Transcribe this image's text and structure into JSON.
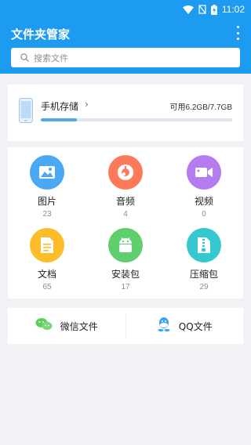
{
  "status_bar": {
    "time": "11:02",
    "icons": [
      "wifi-icon",
      "signal-off-icon",
      "battery-charging-icon"
    ]
  },
  "app_bar": {
    "title": "文件夹管家",
    "menu_icon": "more-vert-icon"
  },
  "search": {
    "placeholder": "搜索文件",
    "icon": "search-icon"
  },
  "storage": {
    "title": "手机存储",
    "chevron": "›",
    "summary": "可用6.2GB/7.7GB",
    "used_fraction": 0.19,
    "icon": "phone-icon"
  },
  "categories": [
    {
      "label": "图片",
      "count": "23",
      "icon": "image-icon",
      "color": "#4aa8f4"
    },
    {
      "label": "音频",
      "count": "4",
      "icon": "music-icon",
      "color": "#ff7a5a"
    },
    {
      "label": "视频",
      "count": "0",
      "icon": "video-icon",
      "color": "#b57cf0"
    },
    {
      "label": "文档",
      "count": "65",
      "icon": "document-icon",
      "color": "#fdbd2a"
    },
    {
      "label": "安装包",
      "count": "17",
      "icon": "android-icon",
      "color": "#5fcf6d"
    },
    {
      "label": "压缩包",
      "count": "29",
      "icon": "zip-icon",
      "color": "#35c9cf"
    }
  ],
  "shortcuts": [
    {
      "label": "微信文件",
      "icon": "wechat-icon",
      "color": "#5fce5b"
    },
    {
      "label": "QQ文件",
      "icon": "qq-icon",
      "color": "#3aa4f5"
    }
  ]
}
